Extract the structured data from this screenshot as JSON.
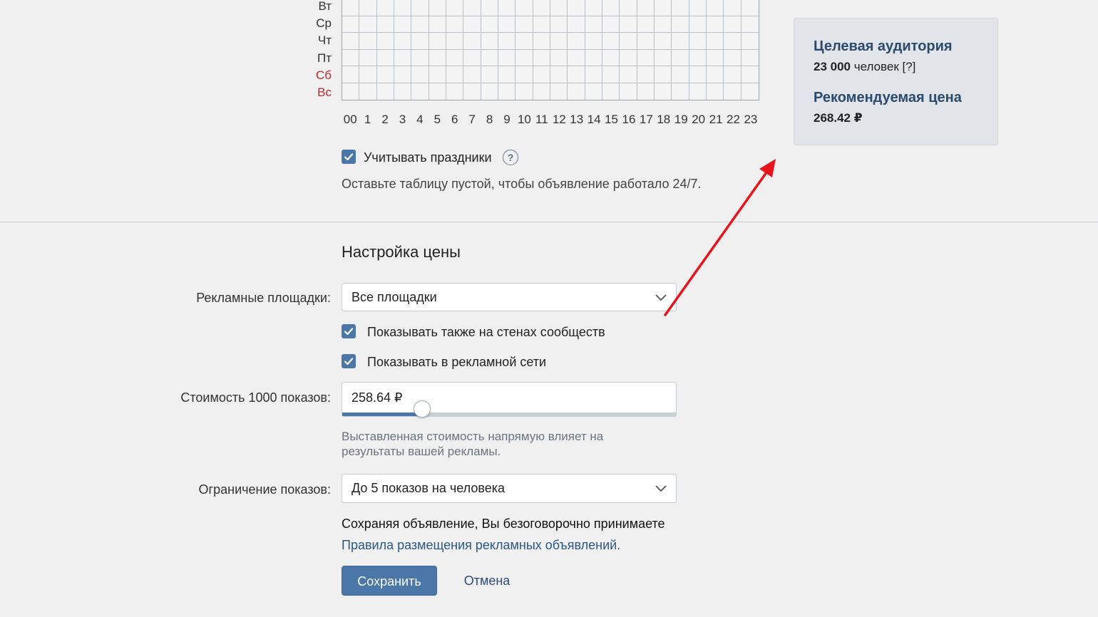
{
  "schedule": {
    "days": [
      {
        "label": "Вт",
        "weekend": false
      },
      {
        "label": "Ср",
        "weekend": false
      },
      {
        "label": "Чт",
        "weekend": false
      },
      {
        "label": "Пт",
        "weekend": false
      },
      {
        "label": "Сб",
        "weekend": true
      },
      {
        "label": "Вс",
        "weekend": true
      }
    ],
    "hours": [
      "00",
      "1",
      "2",
      "3",
      "4",
      "5",
      "6",
      "7",
      "8",
      "9",
      "10",
      "11",
      "12",
      "13",
      "14",
      "15",
      "16",
      "17",
      "18",
      "19",
      "20",
      "21",
      "22",
      "23"
    ],
    "holidays_label": "Учитывать праздники",
    "holidays_checked": true,
    "help_icon": "?",
    "hint": "Оставьте таблицу пустой, чтобы объявление работало 24/7."
  },
  "price_settings": {
    "title": "Настройка цены",
    "platforms": {
      "label": "Рекламные площадки:",
      "value": "Все площадки"
    },
    "show_on_walls": {
      "label": "Показывать также на стенах сообществ",
      "checked": true
    },
    "show_in_network": {
      "label": "Показывать в рекламной сети",
      "checked": true
    },
    "cost": {
      "label": "Стоимость 1000 показов:",
      "value": "258.64 ₽",
      "slider_fraction": 0.24,
      "hint": "Выставленная стоимость напрямую влияет на результаты вашей рекламы."
    },
    "limit": {
      "label": "Ограничение показов:",
      "value": "До 5 показов на человека"
    },
    "terms_text": "Сохраняя объявление, Вы безоговорочно принимаете",
    "terms_link": "Правила размещения рекламных объявлений.",
    "save_label": "Сохранить",
    "cancel_label": "Отмена"
  },
  "info_panel": {
    "audience_title": "Целевая аудитория",
    "audience_count": "23 000",
    "audience_suffix": "человек [?]",
    "price_title": "Рекомендуемая цена",
    "price_value": "268.42 ₽"
  },
  "colors": {
    "accent": "#4a76a8",
    "weekend": "#c0282d",
    "annotation_arrow": "#e8141c"
  }
}
